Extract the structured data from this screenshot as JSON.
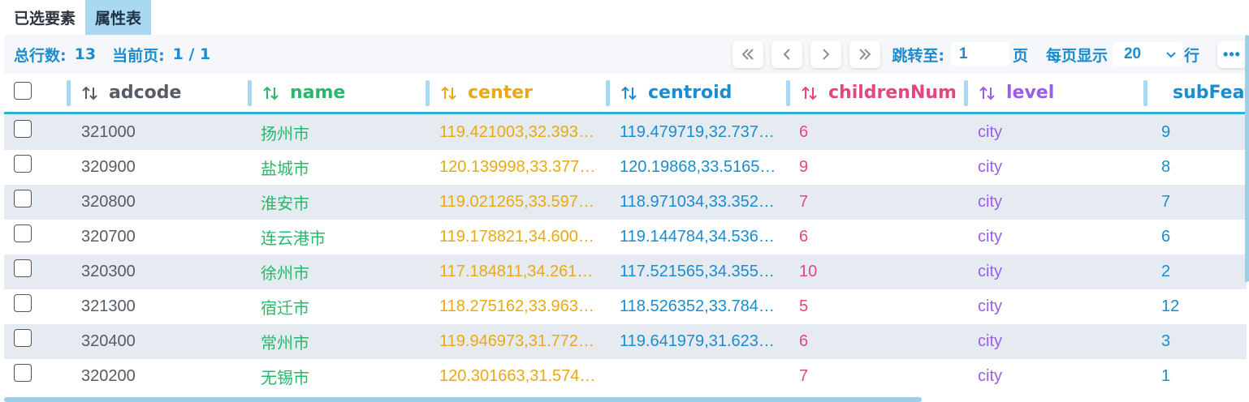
{
  "tabs": [
    {
      "label": "已选要素",
      "active": false
    },
    {
      "label": "属性表",
      "active": true
    }
  ],
  "toolbar": {
    "total_label": "总行数:",
    "total_value": "13",
    "page_label": "当前页:",
    "page_value": "1 / 1",
    "jump_label": "跳转至:",
    "jump_value": "1",
    "page_unit": "页",
    "per_page_label": "每页显示",
    "per_page_value": "20",
    "per_page_unit": "行",
    "more_label": "•••"
  },
  "columns": [
    {
      "key": "adcode",
      "label": "adcode",
      "color": "#555c66"
    },
    {
      "key": "name",
      "label": "name",
      "color": "#27b86a"
    },
    {
      "key": "center",
      "label": "center",
      "color": "#e8a913"
    },
    {
      "key": "centroid",
      "label": "centroid",
      "color": "#1a8ccf"
    },
    {
      "key": "childrenNum",
      "label": "childrenNum",
      "color": "#e64582"
    },
    {
      "key": "level",
      "label": "level",
      "color": "#9a5ee6"
    },
    {
      "key": "subFeature",
      "label": "subFeatu",
      "color": "#1a8ccf"
    }
  ],
  "rows": [
    {
      "adcode": "321000",
      "name": "扬州市",
      "center": "119.421003,32.393…",
      "centroid": "119.479719,32.737…",
      "childrenNum": "6",
      "level": "city",
      "subFeature": "9"
    },
    {
      "adcode": "320900",
      "name": "盐城市",
      "center": "120.139998,33.377…",
      "centroid": "120.19868,33.5165…",
      "childrenNum": "9",
      "level": "city",
      "subFeature": "8"
    },
    {
      "adcode": "320800",
      "name": "淮安市",
      "center": "119.021265,33.597…",
      "centroid": "118.971034,33.352…",
      "childrenNum": "7",
      "level": "city",
      "subFeature": "7"
    },
    {
      "adcode": "320700",
      "name": "连云港市",
      "center": "119.178821,34.600…",
      "centroid": "119.144784,34.536…",
      "childrenNum": "6",
      "level": "city",
      "subFeature": "6"
    },
    {
      "adcode": "320300",
      "name": "徐州市",
      "center": "117.184811,34.261…",
      "centroid": "117.521565,34.355…",
      "childrenNum": "10",
      "level": "city",
      "subFeature": "2"
    },
    {
      "adcode": "321300",
      "name": "宿迁市",
      "center": "118.275162,33.963…",
      "centroid": "118.526352,33.784…",
      "childrenNum": "5",
      "level": "city",
      "subFeature": "12"
    },
    {
      "adcode": "320400",
      "name": "常州市",
      "center": "119.946973,31.772…",
      "centroid": "119.641979,31.623…",
      "childrenNum": "6",
      "level": "city",
      "subFeature": "3"
    },
    {
      "adcode": "320200",
      "name": "无锡市",
      "center": "120.301663,31.574…",
      "centroid": "",
      "childrenNum": "7",
      "level": "city",
      "subFeature": "1"
    }
  ]
}
